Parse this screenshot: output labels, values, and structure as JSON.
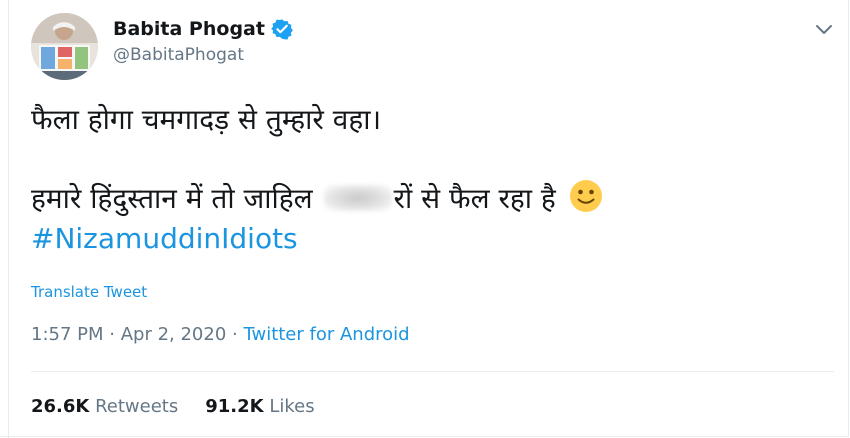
{
  "author": {
    "name": "Babita Phogat",
    "handle": "@BabitaPhogat",
    "verified": true,
    "avatar_icon": "profile-photo"
  },
  "tweet": {
    "line1": "फैला होगा चमगादड़ से तुम्हारे वहा।",
    "line2_before": "हमारे हिंदुस्तान में तो जाहिल",
    "line2_after": "रों से फैल रहा है",
    "emoji": "slightly-smiling-face-icon",
    "hashtag": "#NizamuddinIdiots"
  },
  "translate_label": "Translate Tweet",
  "meta": {
    "time": "1:57 PM",
    "separator1": " · ",
    "date": "Apr 2, 2020",
    "separator2": " · ",
    "source": "Twitter for Android"
  },
  "stats": {
    "retweets_count": "26.6K",
    "retweets_label": "Retweets",
    "likes_count": "91.2K",
    "likes_label": "Likes"
  },
  "colors": {
    "link": "#1b95e0",
    "muted": "#657786",
    "text": "#14171a",
    "divider": "#e6ecf0"
  }
}
